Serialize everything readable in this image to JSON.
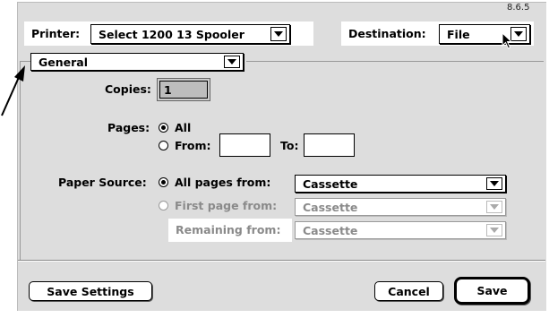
{
  "version": "8.6.5",
  "printer": {
    "label": "Printer:",
    "value": "Select 1200 13 Spooler"
  },
  "destination": {
    "label": "Destination:",
    "value": "File"
  },
  "panel_popup": {
    "value": "General"
  },
  "copies": {
    "label": "Copies:",
    "value": "1"
  },
  "pages": {
    "label": "Pages:",
    "all_label": "All",
    "from_label": "From:",
    "to_label": "To:",
    "from_value": "",
    "to_value": ""
  },
  "paper_source": {
    "label": "Paper Source:",
    "all_pages_label": "All pages from:",
    "all_pages_value": "Cassette",
    "first_page_label": "First page from:",
    "first_page_value": "Cassette",
    "remaining_label": "Remaining from:",
    "remaining_value": "Cassette"
  },
  "buttons": {
    "save_settings": "Save Settings",
    "cancel": "Cancel",
    "save": "Save"
  }
}
